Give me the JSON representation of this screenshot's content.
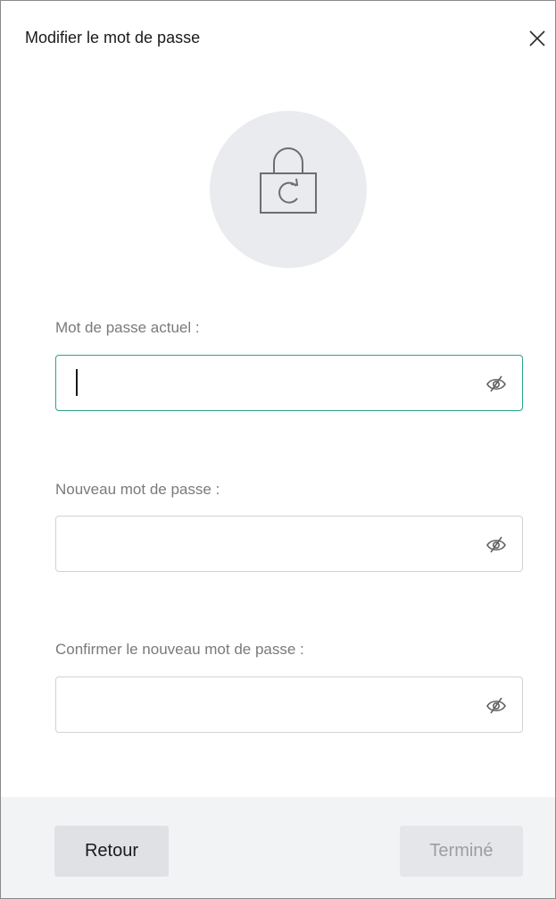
{
  "dialog": {
    "title": "Modifier le mot de passe",
    "close_icon": "close-icon",
    "header_icon": "lock-refresh-icon"
  },
  "fields": {
    "current": {
      "label": "Mot de passe actuel :",
      "value": "",
      "focused": true,
      "toggle_icon": "eye-slash-icon"
    },
    "new": {
      "label": "Nouveau mot de passe :",
      "value": "",
      "focused": false,
      "toggle_icon": "eye-slash-icon"
    },
    "confirm": {
      "label": "Confirmer le nouveau mot de passe :",
      "value": "",
      "focused": false,
      "toggle_icon": "eye-slash-icon"
    }
  },
  "footer": {
    "back_label": "Retour",
    "done_label": "Terminé",
    "done_disabled": true
  },
  "colors": {
    "focus_border": "#2aa389",
    "avatar_bg": "#e9ebee",
    "footer_bg": "#f2f3f4"
  }
}
